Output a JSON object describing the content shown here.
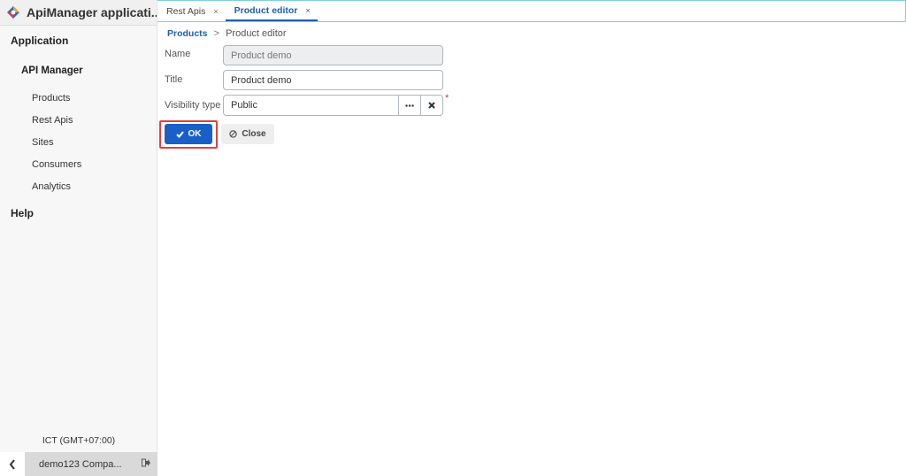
{
  "app": {
    "title": "ApiManager applicati..."
  },
  "sidebar": {
    "section_application": "Application",
    "group_api_manager": "API Manager",
    "items": [
      "Products",
      "Rest Apis",
      "Sites",
      "Consumers",
      "Analytics"
    ],
    "section_help": "Help",
    "timezone": "ICT (GMT+07:00)",
    "user": "demo123 Compa..."
  },
  "tabs": [
    {
      "label": "Rest Apis",
      "close": "×",
      "active": false
    },
    {
      "label": "Product editor",
      "close": "×",
      "active": true
    }
  ],
  "breadcrumb": {
    "link": "Products",
    "separator": ">",
    "current": "Product editor"
  },
  "form": {
    "name_label": "Name",
    "name_value": "Product demo",
    "title_label": "Title",
    "title_value": "Product demo",
    "visibility_label": "Visibility type",
    "visibility_value": "Public",
    "required_mark": "*"
  },
  "actions": {
    "ok_label": "OK",
    "close_label": "Close"
  },
  "colors": {
    "accent": "#1a5fc7",
    "highlight": "#e04040",
    "required": "#e03030"
  }
}
